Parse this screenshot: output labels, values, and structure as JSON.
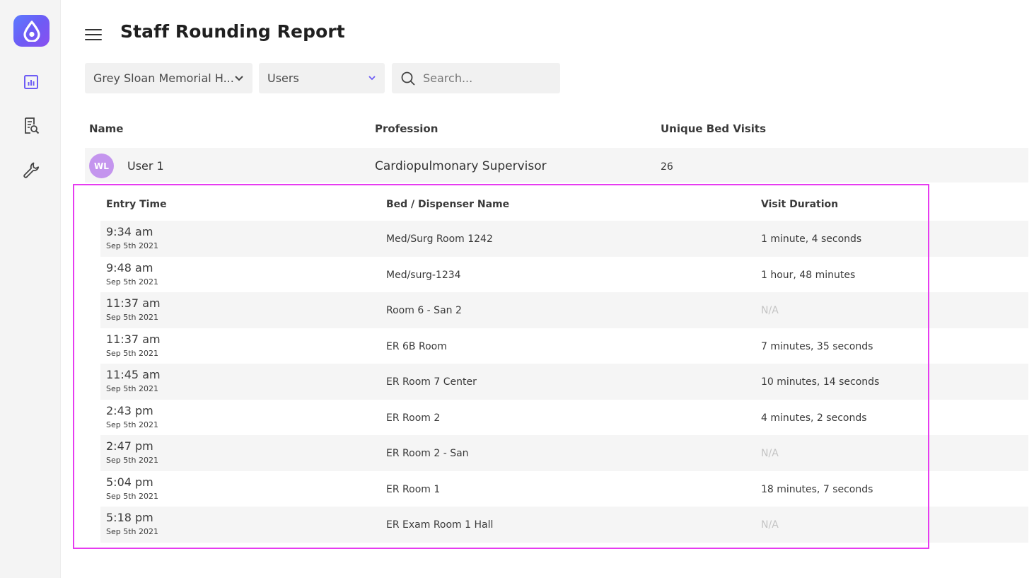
{
  "header": {
    "title": "Staff Rounding Report",
    "menu_icon": "hamburger-menu-icon"
  },
  "sidebar": {
    "logo_icon": "drop-icon",
    "items": [
      {
        "icon": "bar-chart-icon",
        "active": true
      },
      {
        "icon": "report-search-icon",
        "active": false
      },
      {
        "icon": "wrench-icon",
        "active": false
      }
    ]
  },
  "filters": {
    "facility": "Grey Sloan Memorial H...",
    "type": "Users",
    "search_placeholder": "Search..."
  },
  "table": {
    "columns": [
      "Name",
      "Profession",
      "Unique Bed Visits"
    ],
    "user": {
      "initials": "WL",
      "name": "User 1",
      "profession": "Cardiopulmonary Supervisor",
      "unique_bed_visits": "26"
    }
  },
  "visits": {
    "columns": [
      "Entry Time",
      "Bed / Dispenser Name",
      "Visit Duration"
    ],
    "rows": [
      {
        "time": "9:34 am",
        "date": "Sep 5th 2021",
        "bed": "Med/Surg Room 1242",
        "duration": "1 minute, 4 seconds"
      },
      {
        "time": "9:48 am",
        "date": "Sep 5th 2021",
        "bed": "Med/surg-1234",
        "duration": "1 hour, 48 minutes"
      },
      {
        "time": "11:37 am",
        "date": "Sep 5th 2021",
        "bed": "Room 6 - San 2",
        "duration": "N/A"
      },
      {
        "time": "11:37 am",
        "date": "Sep 5th 2021",
        "bed": "ER 6B Room",
        "duration": "7 minutes, 35 seconds"
      },
      {
        "time": "11:45 am",
        "date": "Sep 5th 2021",
        "bed": "ER Room 7 Center",
        "duration": "10 minutes, 14 seconds"
      },
      {
        "time": "2:43 pm",
        "date": "Sep 5th 2021",
        "bed": "ER Room 2",
        "duration": "4 minutes, 2 seconds"
      },
      {
        "time": "2:47 pm",
        "date": "Sep 5th 2021",
        "bed": "ER Room 2 - San",
        "duration": "N/A"
      },
      {
        "time": "5:04 pm",
        "date": "Sep 5th 2021",
        "bed": "ER Room 1",
        "duration": "18 minutes, 7 seconds"
      },
      {
        "time": "5:18 pm",
        "date": "Sep 5th 2021",
        "bed": "ER Exam Room 1 Hall",
        "duration": "N/A"
      }
    ]
  },
  "colors": {
    "accent": "#6d5cf5",
    "highlight_border": "#e63cf0",
    "avatar": "#c495ee"
  }
}
